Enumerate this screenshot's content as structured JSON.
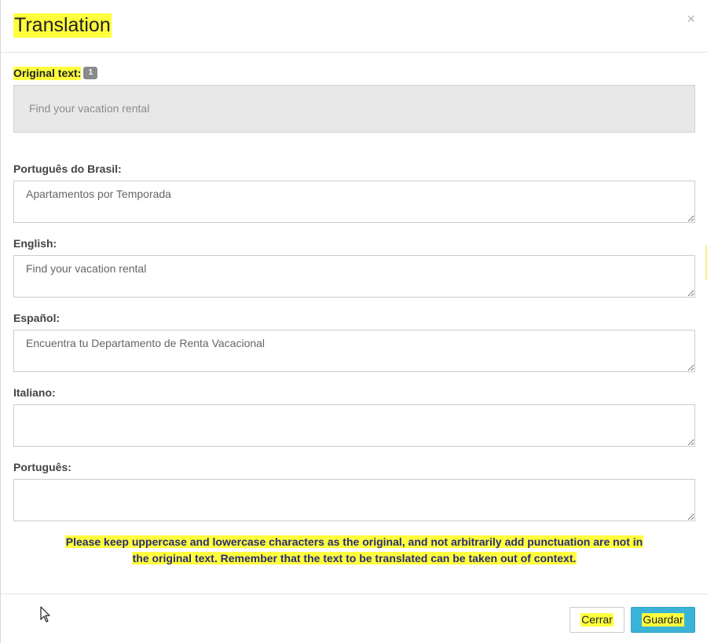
{
  "modal": {
    "title": "Translation",
    "close_symbol": "×",
    "close_icon": "close-icon"
  },
  "original": {
    "label": "Original text:",
    "badge": "1",
    "text": "Find your vacation rental"
  },
  "fields": [
    {
      "label": "Português do Brasil:",
      "value": "Apartamentos por Temporada"
    },
    {
      "label": "English:",
      "value": "Find your vacation rental"
    },
    {
      "label": "Español:",
      "value": "Encuentra tu Departamento de Renta Vacacional"
    },
    {
      "label": "Italiano:",
      "value": ""
    },
    {
      "label": "Português:",
      "value": ""
    }
  ],
  "notice": {
    "line1": "Please keep uppercase and lowercase characters as the original, and not arbitrarily add punctuation are not in",
    "line2": "the original text. Remember that the text to be translated can be taken out of context."
  },
  "footer": {
    "cancel_label": "Cerrar",
    "save_label": "Guardar"
  },
  "colors": {
    "highlight": "#ffff3d",
    "primary_button": "#3bb3d6",
    "readonly_bg": "#e8e8e8"
  }
}
